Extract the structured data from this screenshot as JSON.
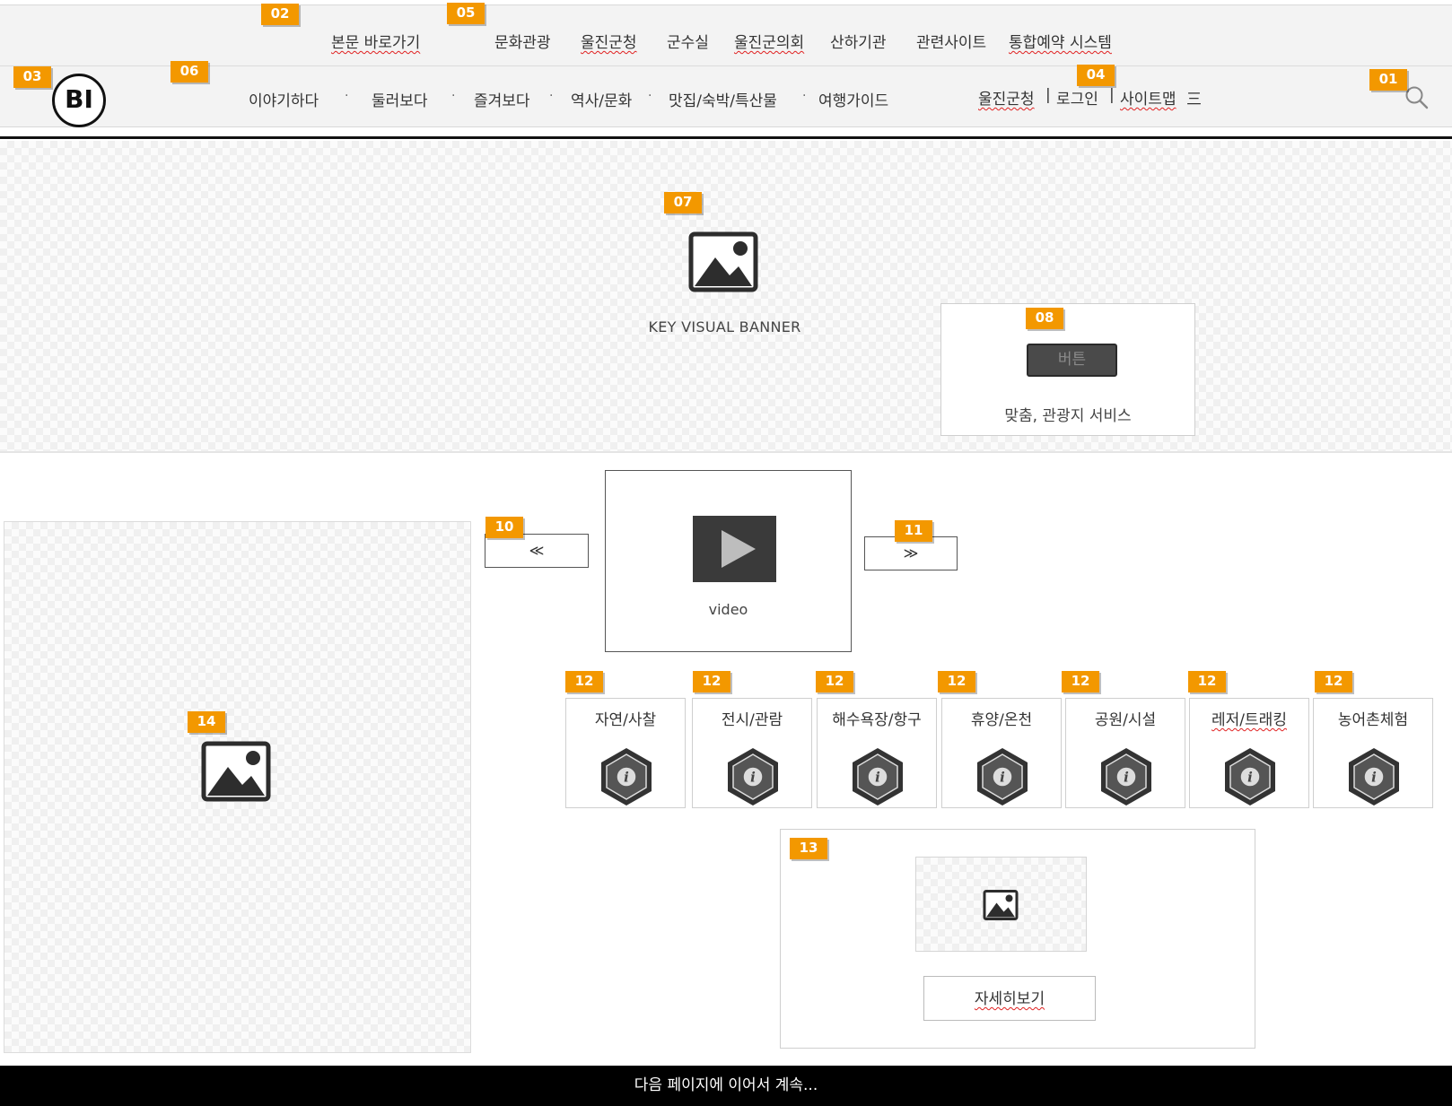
{
  "top_links": {
    "skip": "본문 바로가기",
    "items": [
      "문화관광",
      "울진군청",
      "군수실",
      "울진군의회",
      "산하기관",
      "관련사이트",
      "통합예약 시스템"
    ]
  },
  "logo": {
    "text": "BI"
  },
  "nav": {
    "items": [
      "이야기하다",
      "둘러보다",
      "즐겨보다",
      "역사/문화",
      "맛집/숙박/특산물",
      "여행가이드"
    ],
    "separator": "·"
  },
  "util": {
    "county": "울진군청",
    "sep": "|",
    "login": "로그인",
    "sitemap": "사이트맵",
    "menu_glyph": "三"
  },
  "hero": {
    "label": "KEY VISUAL BANNER"
  },
  "service": {
    "button": "버튼",
    "text": "맞춤, 관광지 서비스"
  },
  "video": {
    "label": "video",
    "prev": "≪",
    "next": "≫"
  },
  "categories": [
    "자연/사찰",
    "전시/관람",
    "해수욕장/항구",
    "휴양/온천",
    "공원/시설",
    "레저/트래킹",
    "농어촌체험"
  ],
  "info": {
    "button": "자세히보기"
  },
  "footer": {
    "text": "다음 페이지에 이어서 계속..."
  },
  "badges": {
    "b01": "01",
    "b02": "02",
    "b03": "03",
    "b04": "04",
    "b05": "05",
    "b06": "06",
    "b07": "07",
    "b08": "08",
    "b10": "10",
    "b11": "11",
    "b12": "12",
    "b13": "13",
    "b14": "14"
  },
  "colors": {
    "badge": "#f39800",
    "footer_bg": "#000000",
    "button_dark": "#4a4a4a"
  }
}
